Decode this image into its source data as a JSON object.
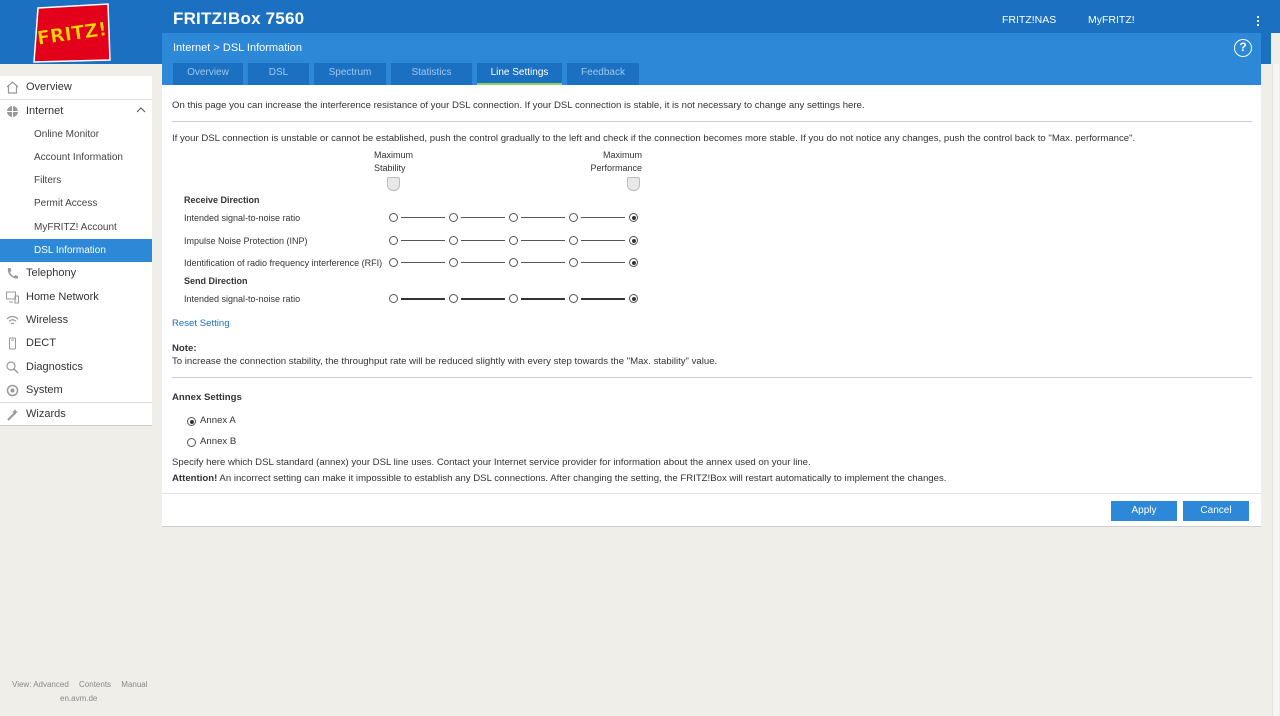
{
  "header": {
    "title": "FRITZ!Box 7560",
    "links": [
      "FRITZ!NAS",
      "MyFRITZ!"
    ],
    "logo_text": "FRITZ!"
  },
  "nav": {
    "items": [
      {
        "label": "Overview",
        "icon": "home-icon"
      },
      {
        "label": "Internet",
        "icon": "globe-icon"
      },
      {
        "label": "Online Monitor"
      },
      {
        "label": "Account Information"
      },
      {
        "label": "Filters"
      },
      {
        "label": "Permit Access"
      },
      {
        "label": "MyFRITZ! Account"
      },
      {
        "label": "DSL Information"
      },
      {
        "label": "Telephony",
        "icon": "phone-icon"
      },
      {
        "label": "Home Network",
        "icon": "network-icon"
      },
      {
        "label": "Wireless",
        "icon": "wifi-icon"
      },
      {
        "label": "DECT",
        "icon": "dect-icon"
      },
      {
        "label": "Diagnostics",
        "icon": "diagnostics-icon"
      },
      {
        "label": "System",
        "icon": "system-icon"
      },
      {
        "label": "Wizards",
        "icon": "wizard-icon"
      }
    ],
    "active": "DSL Information"
  },
  "footer": {
    "links": [
      "View: Advanced",
      "Contents",
      "Manual"
    ],
    "site": "en.avm.de"
  },
  "breadcrumb": {
    "parent": "Internet",
    "separator": ">",
    "current": "DSL Information"
  },
  "tabs": [
    "Overview",
    "DSL",
    "Spectrum",
    "Statistics",
    "Line Settings",
    "Feedback"
  ],
  "active_tab": "Line Settings",
  "content": {
    "intro": "On this page you can increase the interference resistance of your DSL connection. If your DSL connection is stable, it is not necessary to change any settings here.",
    "instruction": "If your DSL connection is unstable or cannot be established, push the control gradually to the left and check if the connection becomes more stable. If you do not notice any changes, push the control back to \"Max. performance\".",
    "slider_left_label_1": "Maximum",
    "slider_left_label_2": "Stability",
    "slider_right_label_1": "Maximum",
    "slider_right_label_2": "Performance",
    "receive_heading": "Receive Direction",
    "send_heading": "Send Direction",
    "rows": [
      {
        "label": "Intended signal-to-noise ratio",
        "selected_step": 5
      },
      {
        "label": "Impulse Noise Protection (INP)",
        "selected_step": 5
      },
      {
        "label": "Identification of radio frequency interference (RFI)",
        "selected_step": 5
      },
      {
        "label": "Intended signal-to-noise ratio",
        "selected_step": 5
      }
    ],
    "reset_link": "Reset Setting",
    "note_heading": "Note:",
    "note_text": "To increase the connection stability, the throughput rate will be reduced slightly with every step towards the \"Max. stability\" value.",
    "annex_heading": "Annex Settings",
    "annex_options": [
      "Annex A",
      "Annex B"
    ],
    "annex_selected": "Annex A",
    "annex_info": "Specify here which DSL standard (annex) your DSL line uses. Contact your Internet service provider for information about the annex used on your line.",
    "attention_label": "Attention!",
    "attention_text": " An incorrect setting can make it impossible to establish any DSL connections. After changing the setting, the FRITZ!Box will restart automatically to implement the changes."
  },
  "buttons": {
    "apply": "Apply",
    "cancel": "Cancel"
  },
  "colors": {
    "brand_blue": "#1b70c1",
    "panel_blue": "#2d88d8",
    "active_tab_underline": "#8cd15b"
  }
}
